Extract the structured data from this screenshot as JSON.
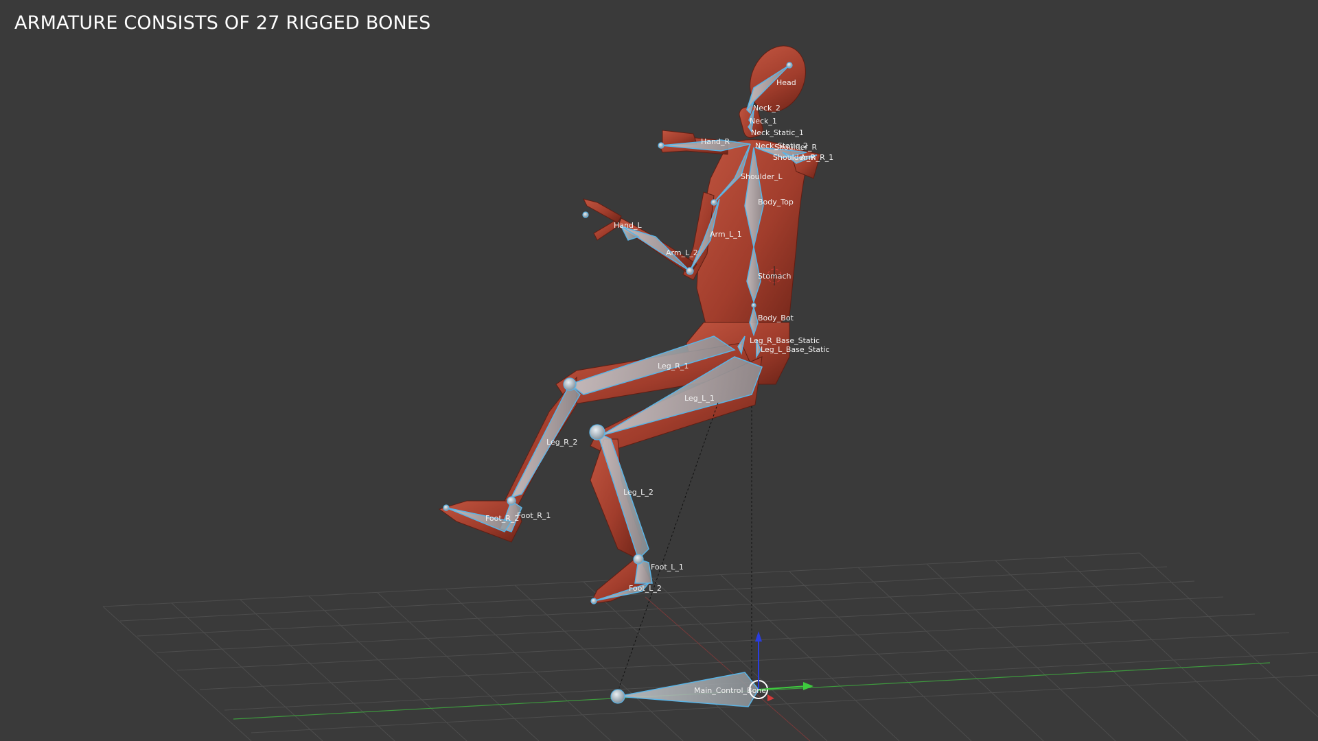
{
  "viewport": {
    "background": "#3a3a3a",
    "caption": "ARMATURE CONSISTS OF 27 RIGGED BONES",
    "bone_color": "#5ab4e6",
    "mesh_color": "#a8412f",
    "grid_axis_x_color": "#d33a3a",
    "grid_axis_y_color": "#3ec93e",
    "gizmo_z_color": "#2a3de0"
  },
  "bones": {
    "head": "Head",
    "neck_2": "Neck_2",
    "neck_1": "Neck_1",
    "neck_static_1": "Neck_Static_1",
    "neck_static_2": "Neck_Static_2",
    "hand_r": "Hand_R",
    "shoulder_r": "Shoulder_R",
    "arm_r_1": "Arm_R_1",
    "shoulder_l": "Shoulder_L",
    "body_top": "Body_Top",
    "hand_l": "Hand_L",
    "arm_l_1": "Arm_L_1",
    "arm_l_2": "Arm_L_2",
    "stomach": "Stomach",
    "body_bot": "Body_Bot",
    "leg_r_base_static": "Leg_R_Base_Static",
    "leg_l_base_static": "Leg_L_Base_Static",
    "leg_r_1": "Leg_R_1",
    "leg_l_1": "Leg_L_1",
    "leg_r_2": "Leg_R_2",
    "leg_l_2": "Leg_L_2",
    "foot_r_1": "Foot_R_1",
    "foot_r_2": "Foot_R_2",
    "foot_l_1": "Foot_L_1",
    "foot_l_2": "Foot_L_2",
    "main_control_bone": "Main_Control_Bone"
  }
}
